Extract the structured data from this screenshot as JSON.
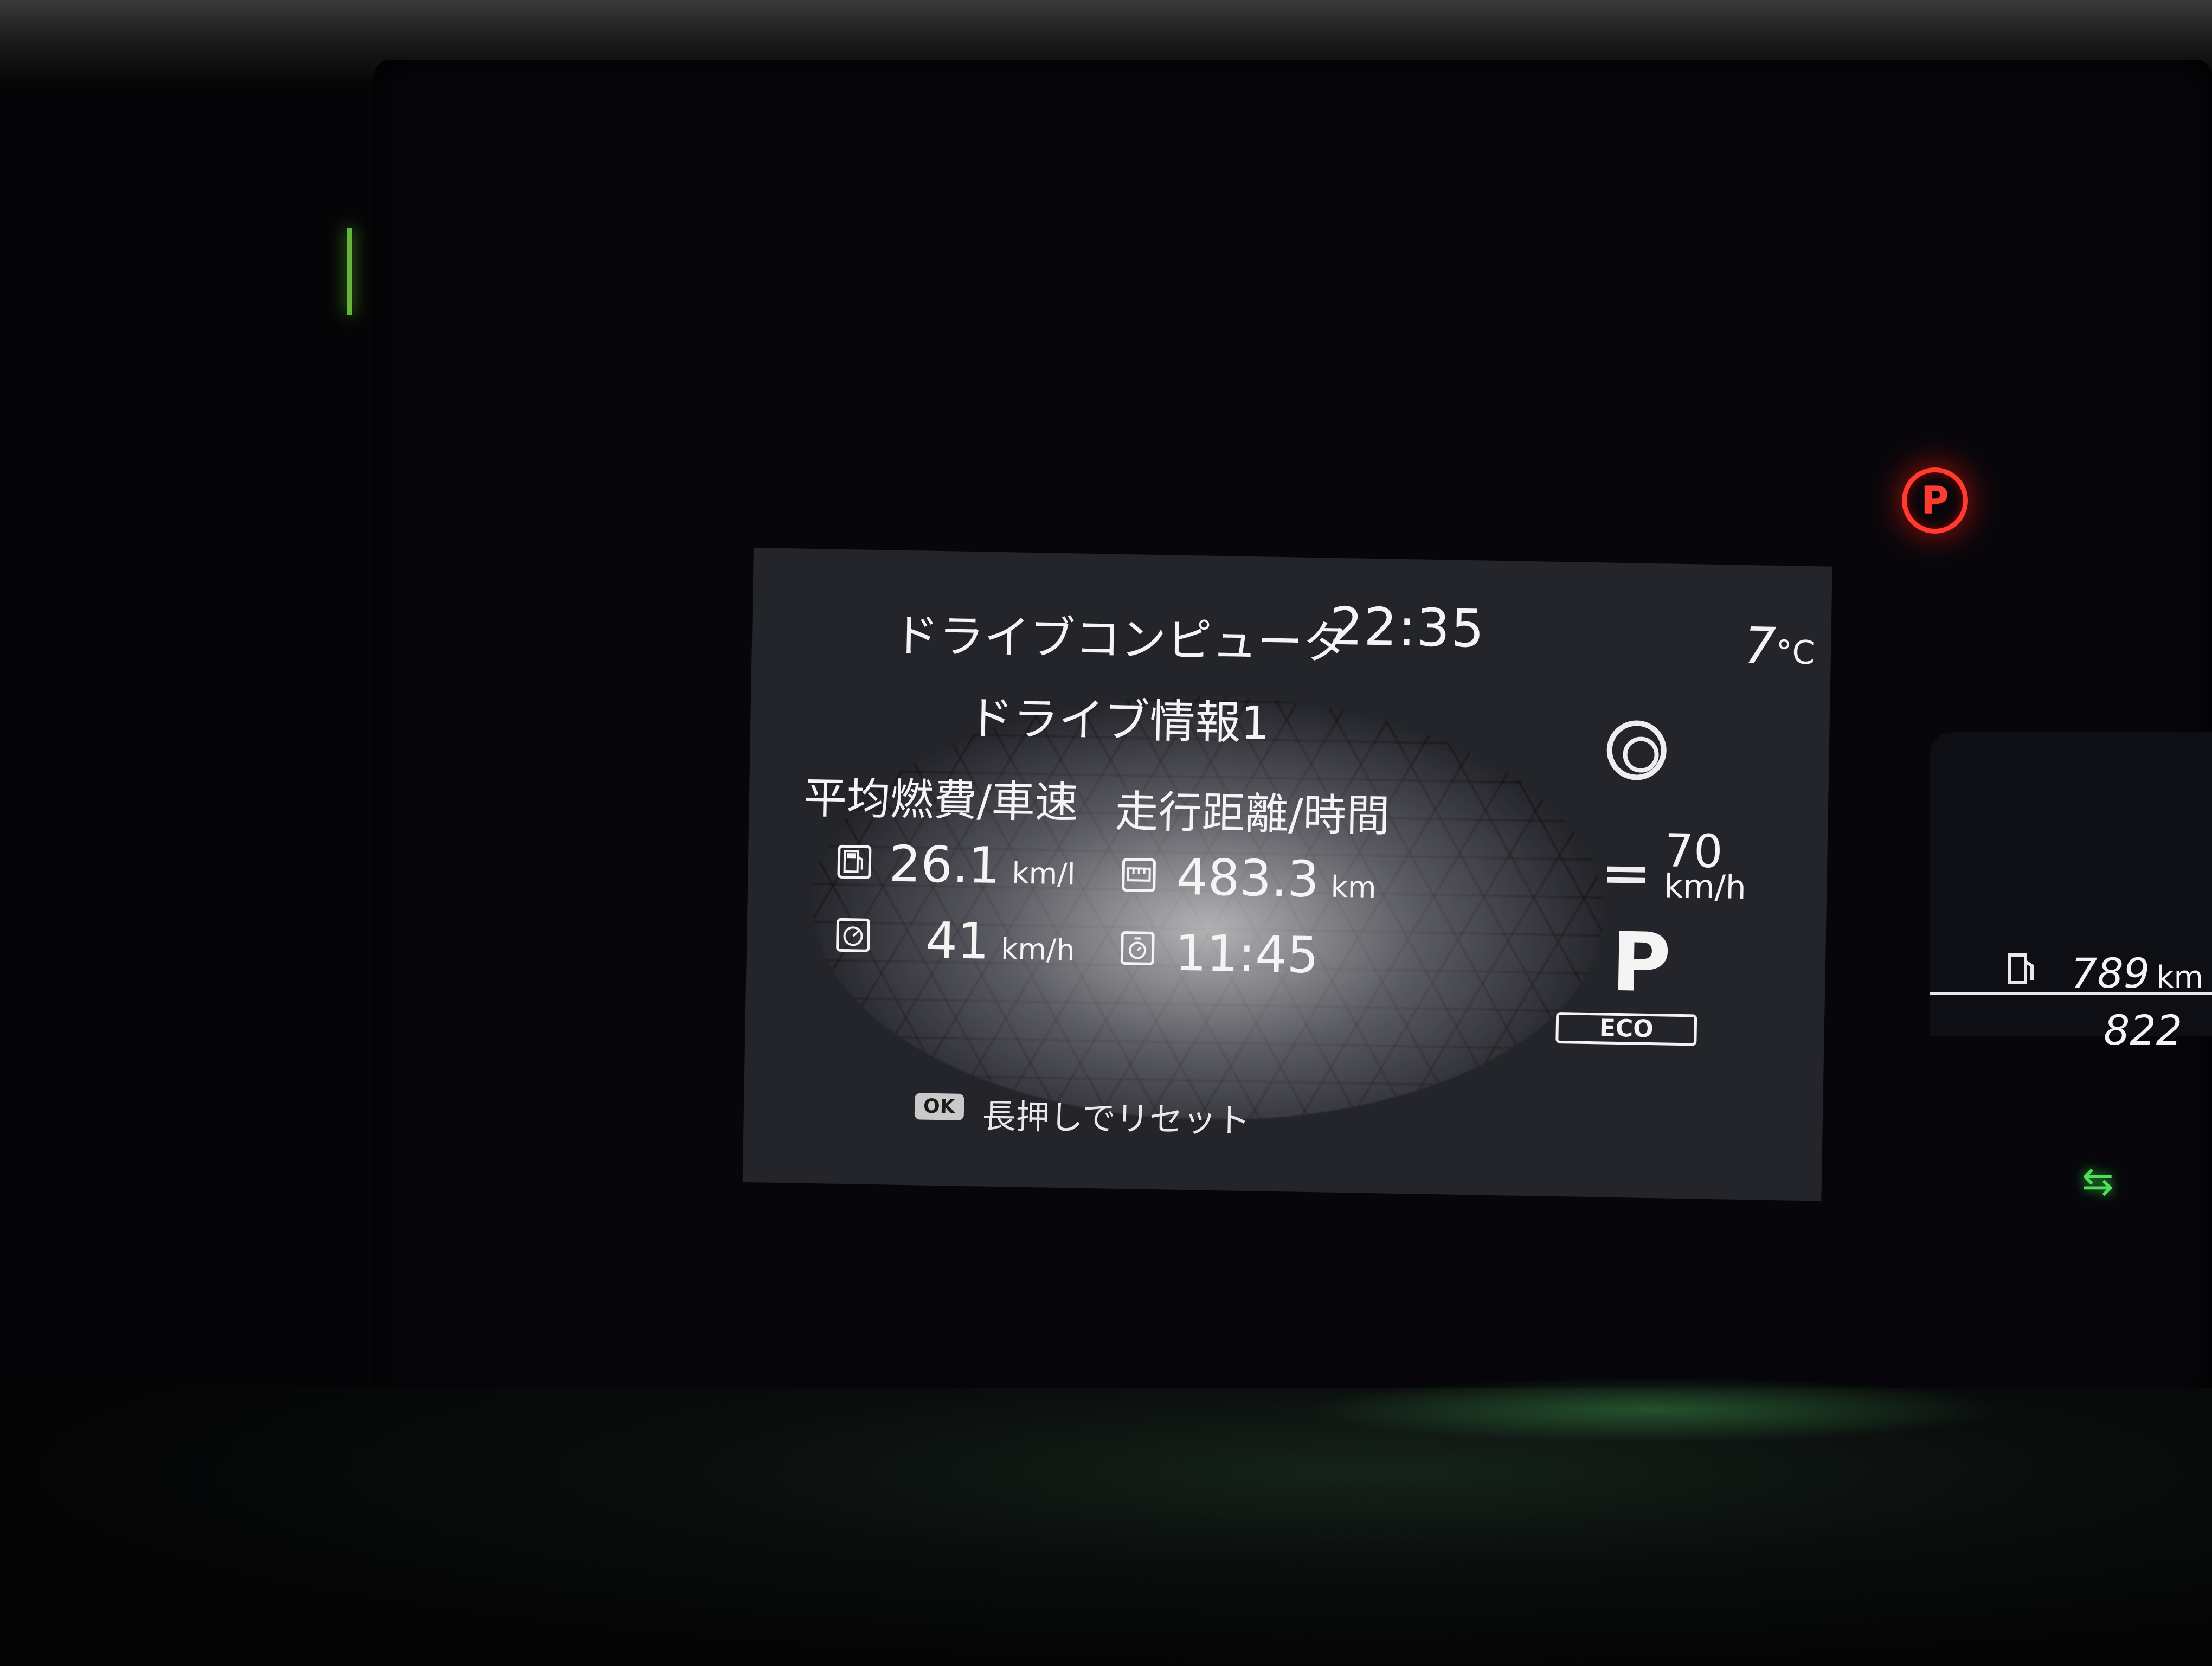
{
  "display": {
    "title": "ドライブコンピュータ",
    "clock": "22:35",
    "temperature": {
      "value": "7",
      "unit": "°C"
    },
    "subtitle": "ドライブ情報1",
    "columns": {
      "left_header": "平均燃費/車速",
      "right_header": "走行距離/時間"
    },
    "stats": {
      "avg_fuel_economy": {
        "value": "26.1",
        "unit": "km/l",
        "icon": "fuel-pump-icon"
      },
      "avg_speed": {
        "value": "41",
        "unit": "km/h",
        "icon": "speedometer-icon"
      },
      "distance": {
        "value": "483.3",
        "unit": "km",
        "icon": "odometer-icon"
      },
      "duration": {
        "value": "11:45",
        "icon": "stopwatch-icon"
      }
    },
    "cruise": {
      "set_speed": "70",
      "unit": "km/h",
      "icon": "driver-assist-icon"
    },
    "gear": "P",
    "mode": "ECO",
    "reset_hint": {
      "button": "OK",
      "text": "長押しでリセット"
    }
  },
  "side_panel": {
    "range": {
      "value": "789",
      "unit": "km"
    },
    "odometer_partial": "822",
    "fuel_icon": "fuel-pump-icon"
  },
  "warning_lamps": {
    "parking_brake": {
      "label": "P",
      "color": "#ff3b30"
    },
    "green_indicator": {
      "icon": "car-indicator-icon",
      "color": "#4fe05a"
    }
  }
}
